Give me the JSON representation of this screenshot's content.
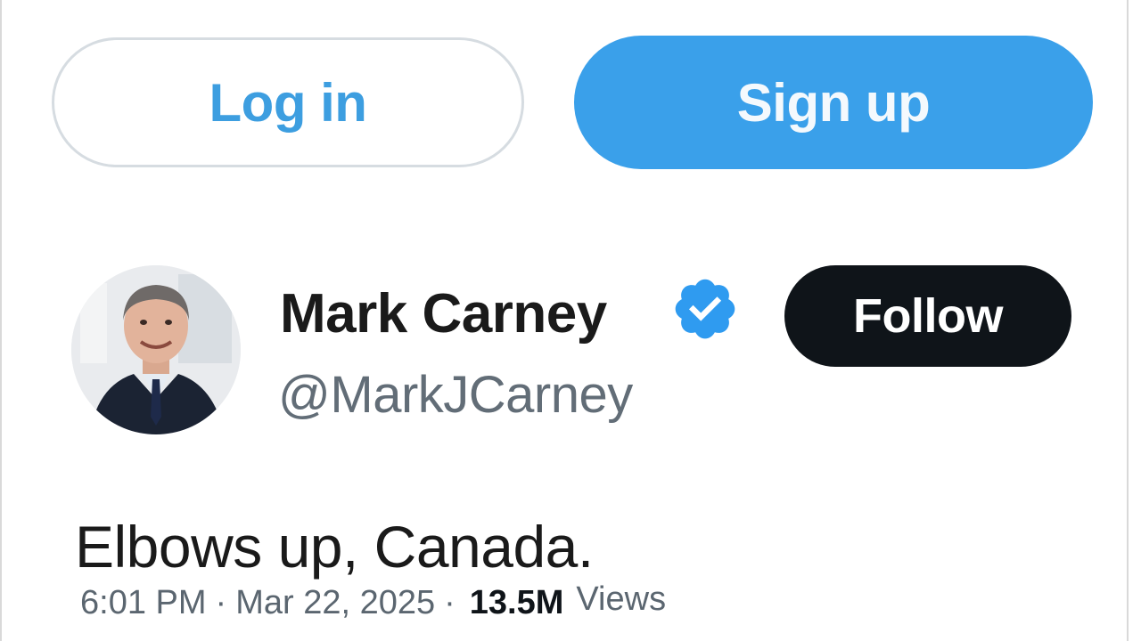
{
  "auth": {
    "login_label": "Log in",
    "signup_label": "Sign up"
  },
  "profile": {
    "display_name": "Mark Carney",
    "handle": "@MarkJCarney",
    "verified": true,
    "follow_label": "Follow"
  },
  "tweet": {
    "text": "Elbows up, Canada.",
    "time": "6:01 PM",
    "separator": "·",
    "date": "Mar 22, 2025",
    "views_count": "13.5M",
    "views_label": "Views"
  },
  "icons": {
    "verified": "verified-badge-icon"
  },
  "colors": {
    "accent_blue": "#3aa0ea",
    "login_text": "#3d9ee0",
    "follow_bg": "#0f1419",
    "muted_text": "#626d77"
  }
}
